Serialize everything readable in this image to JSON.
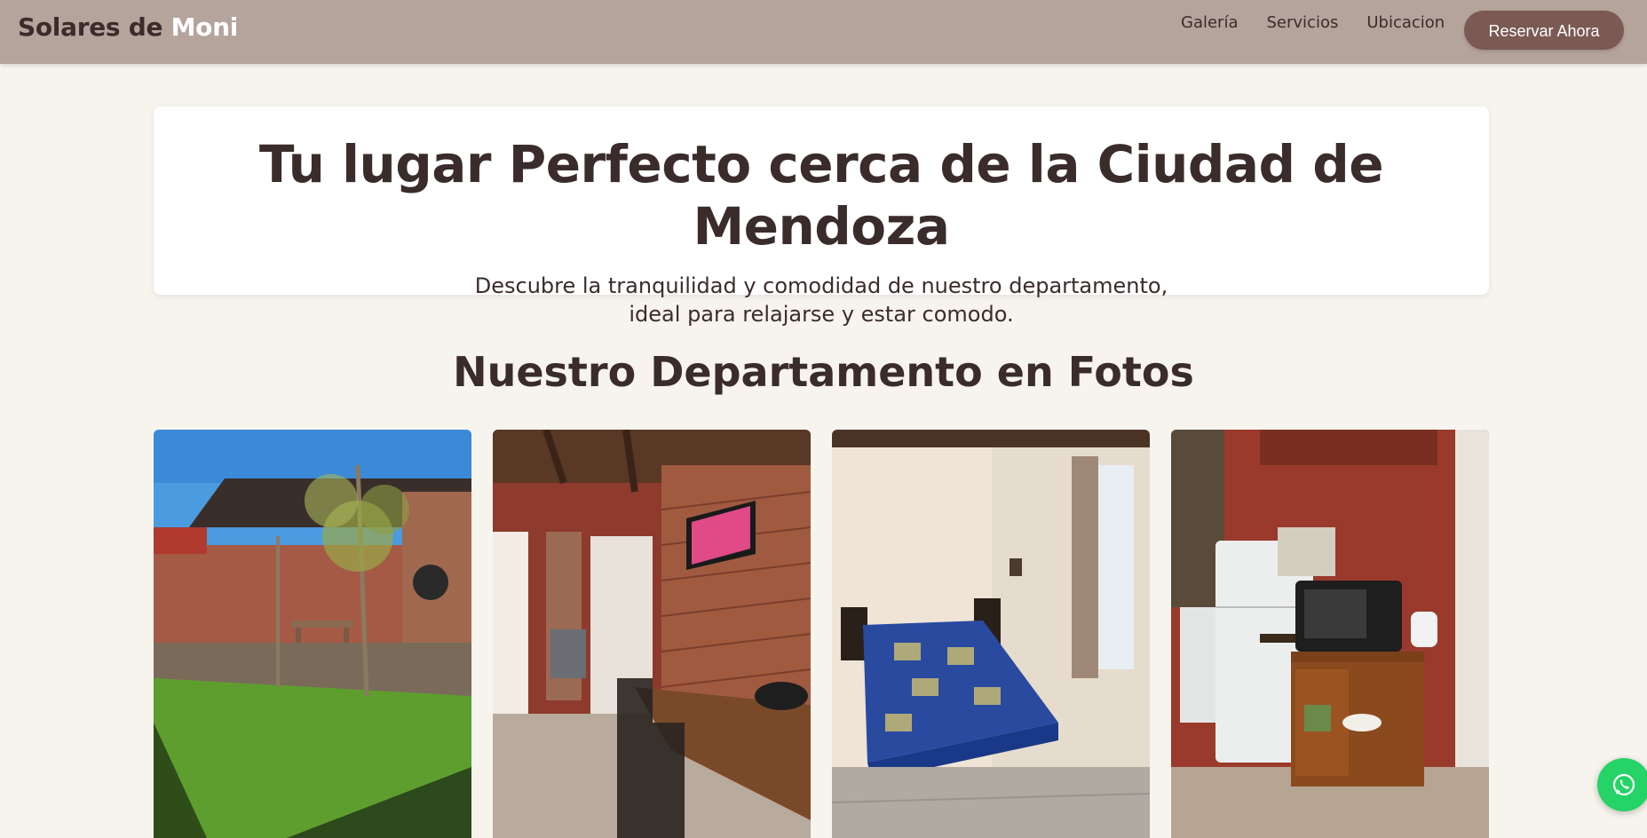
{
  "nav": {
    "brand_part1": "Solares de",
    "brand_part2": "Moni",
    "links": [
      "Galería",
      "Servicios",
      "Ubicacion"
    ],
    "cta_label": "Reservar Ahora"
  },
  "hero": {
    "title": "Tu lugar Perfecto cerca de la Ciudad de Mendoza",
    "subtitle_line1": "Descubre la tranquilidad y comodidad de nuestro departamento,",
    "subtitle_line2": "ideal para relajarse y estar comodo."
  },
  "gallery": {
    "title": "Nuestro Departamento en Fotos"
  },
  "colors": {
    "navbar": "#b5a49c",
    "page_background": "#f7f4ee",
    "accent_button": "#7a5a52",
    "text": "#3b2c2c",
    "whatsapp": "#25d366"
  },
  "icons": {
    "floating_button": "whatsapp-icon"
  }
}
